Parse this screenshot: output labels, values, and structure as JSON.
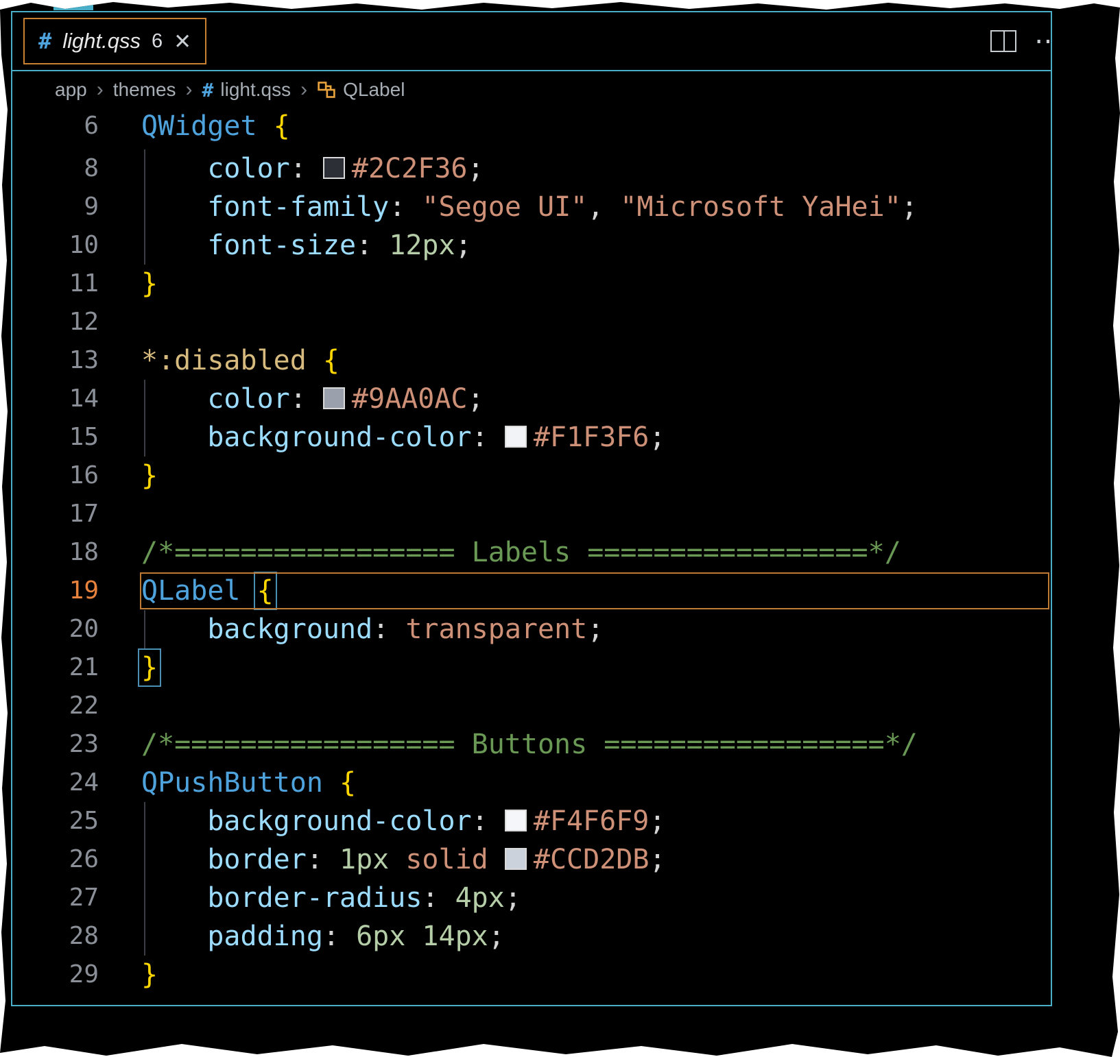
{
  "tabbar": {
    "tab": {
      "icon": "#",
      "title": "light.qss",
      "badge": "6",
      "close_glyph": "✕"
    },
    "actions": {
      "more_glyph": "⋯"
    }
  },
  "breadcrumb": {
    "separator": "›",
    "items": [
      {
        "label": "app"
      },
      {
        "label": "themes"
      },
      {
        "label": "light.qss",
        "icon": "hash"
      },
      {
        "label": "QLabel",
        "icon": "symbol-class"
      }
    ]
  },
  "colors": {
    "window_border": "#49AFC9",
    "tab_active_border": "#C8822F",
    "current_line_border": "#BF7B33",
    "bracket_match_border": "#4A8FB5",
    "selector": "#4FA3DD",
    "property": "#9CDCFE",
    "string": "#CE9178",
    "number": "#B5CEA8",
    "comment": "#6A9955",
    "brace": "#FFD700",
    "swatches": [
      "#2C2F36",
      "#9AA0AC",
      "#F1F3F6",
      "#F4F6F9",
      "#CCD2DB"
    ]
  },
  "editor": {
    "lines": [
      {
        "num": 6,
        "sticky": true,
        "tokens": [
          {
            "t": "QWidget",
            "c": "sel"
          },
          {
            "t": " ",
            "c": "pl"
          },
          {
            "t": "{",
            "c": "br"
          }
        ]
      },
      {
        "num": 8,
        "guide": true,
        "tokens": [
          {
            "t": "    ",
            "c": "pl"
          },
          {
            "t": "color",
            "c": "prop"
          },
          {
            "t": ": ",
            "c": "pu"
          },
          {
            "swatch": "#2C2F36"
          },
          {
            "t": "#2C2F36",
            "c": "str"
          },
          {
            "t": ";",
            "c": "pu"
          }
        ]
      },
      {
        "num": 9,
        "guide": true,
        "tokens": [
          {
            "t": "    ",
            "c": "pl"
          },
          {
            "t": "font-family",
            "c": "prop"
          },
          {
            "t": ": ",
            "c": "pu"
          },
          {
            "t": "\"Segoe UI\"",
            "c": "str"
          },
          {
            "t": ", ",
            "c": "pu"
          },
          {
            "t": "\"Microsoft YaHei\"",
            "c": "str"
          },
          {
            "t": ";",
            "c": "pu"
          }
        ]
      },
      {
        "num": 10,
        "guide": true,
        "tokens": [
          {
            "t": "    ",
            "c": "pl"
          },
          {
            "t": "font-size",
            "c": "prop"
          },
          {
            "t": ": ",
            "c": "pu"
          },
          {
            "t": "12px",
            "c": "num"
          },
          {
            "t": ";",
            "c": "pu"
          }
        ]
      },
      {
        "num": 11,
        "tokens": [
          {
            "t": "}",
            "c": "br"
          }
        ]
      },
      {
        "num": 12,
        "tokens": []
      },
      {
        "num": 13,
        "tokens": [
          {
            "t": "*:disabled",
            "c": "pse"
          },
          {
            "t": " ",
            "c": "pl"
          },
          {
            "t": "{",
            "c": "br"
          }
        ]
      },
      {
        "num": 14,
        "guide": true,
        "tokens": [
          {
            "t": "    ",
            "c": "pl"
          },
          {
            "t": "color",
            "c": "prop"
          },
          {
            "t": ": ",
            "c": "pu"
          },
          {
            "swatch": "#9AA0AC"
          },
          {
            "t": "#9AA0AC",
            "c": "str"
          },
          {
            "t": ";",
            "c": "pu"
          }
        ]
      },
      {
        "num": 15,
        "guide": true,
        "tokens": [
          {
            "t": "    ",
            "c": "pl"
          },
          {
            "t": "background-color",
            "c": "prop"
          },
          {
            "t": ": ",
            "c": "pu"
          },
          {
            "swatch": "#F1F3F6"
          },
          {
            "t": "#F1F3F6",
            "c": "str"
          },
          {
            "t": ";",
            "c": "pu"
          }
        ]
      },
      {
        "num": 16,
        "tokens": [
          {
            "t": "}",
            "c": "br"
          }
        ]
      },
      {
        "num": 17,
        "tokens": []
      },
      {
        "num": 18,
        "tokens": [
          {
            "t": "/*================= Labels =================*/",
            "c": "com"
          }
        ]
      },
      {
        "num": 19,
        "current": true,
        "tokens": [
          {
            "t": "QLabel",
            "c": "sel"
          },
          {
            "t": " ",
            "c": "pl"
          },
          {
            "t": "{",
            "c": "br",
            "box": true
          }
        ]
      },
      {
        "num": 20,
        "guide": true,
        "tokens": [
          {
            "t": "    ",
            "c": "pl"
          },
          {
            "t": "background",
            "c": "prop"
          },
          {
            "t": ": ",
            "c": "pu"
          },
          {
            "t": "transparent",
            "c": "kw"
          },
          {
            "t": ";",
            "c": "pu"
          }
        ]
      },
      {
        "num": 21,
        "tokens": [
          {
            "t": "}",
            "c": "br",
            "box": true
          }
        ]
      },
      {
        "num": 22,
        "tokens": []
      },
      {
        "num": 23,
        "tokens": [
          {
            "t": "/*================= Buttons =================*/",
            "c": "com"
          }
        ]
      },
      {
        "num": 24,
        "tokens": [
          {
            "t": "QPushButton",
            "c": "sel"
          },
          {
            "t": " ",
            "c": "pl"
          },
          {
            "t": "{",
            "c": "br"
          }
        ]
      },
      {
        "num": 25,
        "guide": true,
        "tokens": [
          {
            "t": "    ",
            "c": "pl"
          },
          {
            "t": "background-color",
            "c": "prop"
          },
          {
            "t": ": ",
            "c": "pu"
          },
          {
            "swatch": "#F4F6F9"
          },
          {
            "t": "#F4F6F9",
            "c": "str"
          },
          {
            "t": ";",
            "c": "pu"
          }
        ]
      },
      {
        "num": 26,
        "guide": true,
        "tokens": [
          {
            "t": "    ",
            "c": "pl"
          },
          {
            "t": "border",
            "c": "prop"
          },
          {
            "t": ": ",
            "c": "pu"
          },
          {
            "t": "1px",
            "c": "num"
          },
          {
            "t": " ",
            "c": "pl"
          },
          {
            "t": "solid",
            "c": "kw"
          },
          {
            "t": " ",
            "c": "pl"
          },
          {
            "swatch": "#CCD2DB"
          },
          {
            "t": "#CCD2DB",
            "c": "str"
          },
          {
            "t": ";",
            "c": "pu"
          }
        ]
      },
      {
        "num": 27,
        "guide": true,
        "tokens": [
          {
            "t": "    ",
            "c": "pl"
          },
          {
            "t": "border-radius",
            "c": "prop"
          },
          {
            "t": ": ",
            "c": "pu"
          },
          {
            "t": "4px",
            "c": "num"
          },
          {
            "t": ";",
            "c": "pu"
          }
        ]
      },
      {
        "num": 28,
        "guide": true,
        "tokens": [
          {
            "t": "    ",
            "c": "pl"
          },
          {
            "t": "padding",
            "c": "prop"
          },
          {
            "t": ": ",
            "c": "pu"
          },
          {
            "t": "6px",
            "c": "num"
          },
          {
            "t": " ",
            "c": "pl"
          },
          {
            "t": "14px",
            "c": "num"
          },
          {
            "t": ";",
            "c": "pu"
          }
        ]
      },
      {
        "num": 29,
        "tokens": [
          {
            "t": "}",
            "c": "br"
          }
        ]
      }
    ]
  }
}
